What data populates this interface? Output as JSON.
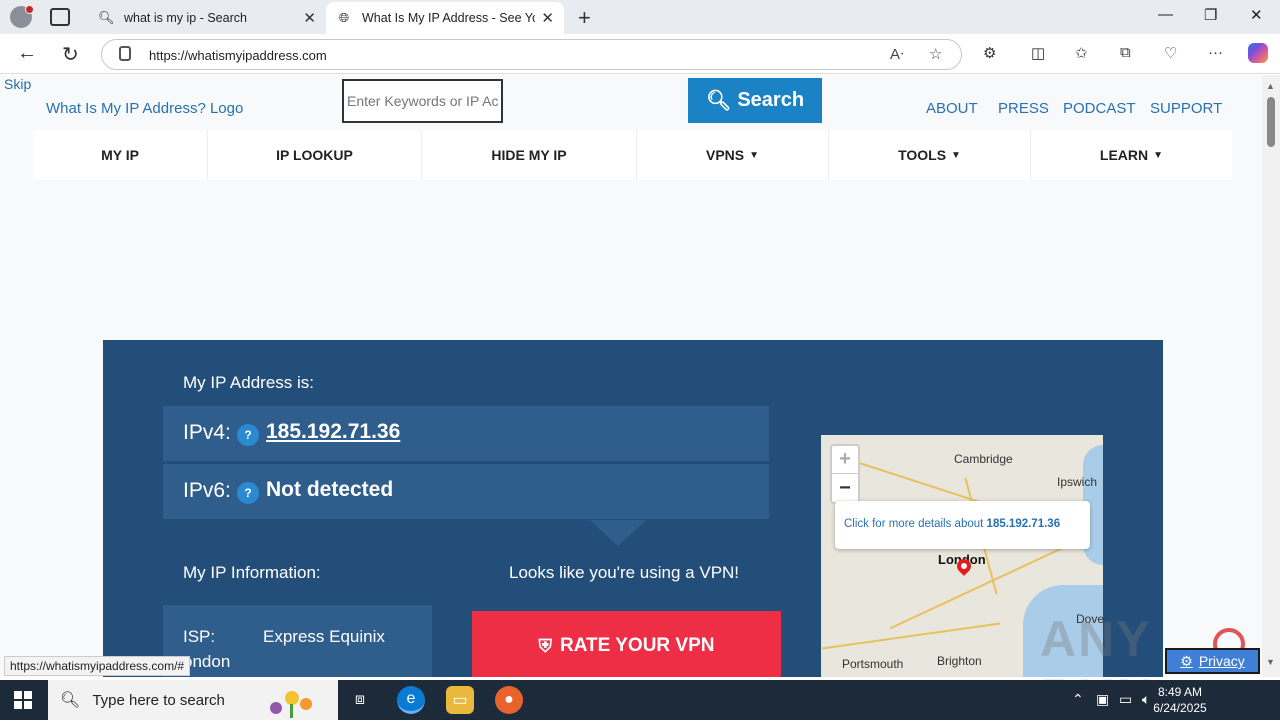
{
  "browser": {
    "tabs": [
      {
        "title": "what is my ip - Search",
        "favicon": "search-icon",
        "active": false
      },
      {
        "title": "What Is My IP Address - See Your",
        "favicon": "globe-icon",
        "active": true
      }
    ],
    "url": "https://whatismyipaddress.com",
    "status_url": "https://whatismyipaddress.com/#"
  },
  "header": {
    "skip": "Skip",
    "logo_alt": "What Is My IP Address? Logo",
    "search_placeholder": "Enter Keywords or IP Ac",
    "search_button": "Search",
    "top_links": [
      "ABOUT",
      "PRESS",
      "PODCAST",
      "SUPPORT"
    ]
  },
  "mainnav": [
    {
      "label": "MY IP",
      "dropdown": false
    },
    {
      "label": "IP LOOKUP",
      "dropdown": false
    },
    {
      "label": "HIDE MY IP",
      "dropdown": false
    },
    {
      "label": "VPNS",
      "dropdown": true
    },
    {
      "label": "TOOLS",
      "dropdown": true
    },
    {
      "label": "LEARN",
      "dropdown": true
    }
  ],
  "ip_panel": {
    "title": "My IP Address is:",
    "ipv4_label": "IPv4:",
    "ipv4_value": "185.192.71.36",
    "ipv6_label": "IPv6:",
    "ipv6_value": "Not detected",
    "help": "?",
    "info_title": "My IP Information:",
    "isp_label": "ISP:",
    "isp_value": "Express Equinix",
    "city_partial": "ondon",
    "vpn_message": "Looks like you're using a VPN!",
    "rate_button": "RATE YOUR VPN"
  },
  "map": {
    "zoom_in": "+",
    "zoom_out": "−",
    "popup_text": "Click for more details about",
    "popup_ip": "185.192.71.36",
    "places": {
      "cambridge": "Cambridge",
      "ipswich": "Ipswich",
      "london": "London",
      "dover": "Dove",
      "portsmouth": "Portsmouth",
      "brighton": "Brighton"
    }
  },
  "overlays": {
    "watermark": "ANY RUN",
    "privacy": "Privacy"
  },
  "taskbar": {
    "search_placeholder": "Type here to search",
    "time": "8:49 AM",
    "date": "6/24/2025"
  },
  "colors": {
    "panel": "#244e7a",
    "row": "#2f5e8d",
    "search_button": "#1b83c5",
    "rate_button": "#ed2e45",
    "link": "#2771b3"
  }
}
